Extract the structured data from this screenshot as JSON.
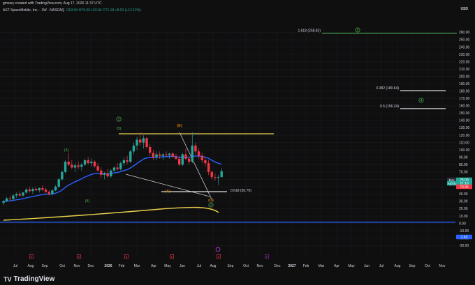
{
  "header": {
    "credit": "gmsery created with TradingView.com, Aug 17, 2026 11:37 UTC",
    "symbol": "AST SpaceMobile, Inc. · 1W · NASDAQ",
    "ohlc": "O63.04 H75.09 L63.04 C71.18 +8.03 (+12.12%)"
  },
  "footer": {
    "brand": "TradingView",
    "logo": "TV"
  },
  "axis": {
    "unit": "USD",
    "price_ticks": [
      260,
      250,
      240,
      230,
      220,
      210,
      200,
      190,
      180,
      170,
      160,
      150,
      140,
      130,
      120,
      110,
      100,
      90,
      80,
      70,
      60,
      50,
      40,
      30,
      20,
      10,
      0,
      -10,
      -20,
      -30
    ],
    "time_ticks": [
      "Jul",
      "Aug",
      "Sep",
      "Oct",
      "Nov",
      "Dec",
      "2026",
      "Feb",
      "Mar",
      "Apr",
      "May",
      "Jun",
      "Jul",
      "Aug",
      "Sep",
      "Oct",
      "Nov",
      "Dec",
      "2027",
      "Feb",
      "Mar",
      "Apr",
      "May",
      "Jun",
      "Jul",
      "Aug",
      "Sep",
      "Oct",
      "Nov"
    ]
  },
  "price_labels": [
    {
      "text": "75.09",
      "color": "#26a69a"
    },
    {
      "text": "71.18",
      "color": "#26a69a"
    },
    {
      "text": "70.96",
      "color": "#f23645"
    },
    {
      "text": "1.63",
      "color": "#2962ff"
    }
  ],
  "price_label_tags": [
    "Buy",
    "ASTS"
  ],
  "fib_levels": [
    {
      "text": "1.618 (258.83)",
      "value": 258.83,
      "color": "#4caf50"
    },
    {
      "text": "0.382 (180.64)",
      "value": 180.64,
      "color": "#ffffff"
    },
    {
      "text": "0.5 (156.24)",
      "value": 156.24,
      "color": "#ffffff"
    },
    {
      "text": "0.618 (50.79)",
      "value": 50.79,
      "color": "#ffffff"
    }
  ],
  "wave_labels": [
    {
      "text": "1",
      "kind": "circle",
      "color": "#4caf50"
    },
    {
      "text": "(5)",
      "kind": "paren",
      "color": "#4caf50"
    },
    {
      "text": "(3)",
      "kind": "paren",
      "color": "#4caf50"
    },
    {
      "text": "(4)",
      "kind": "paren",
      "color": "#4caf50"
    },
    {
      "text": "(B)",
      "kind": "paren",
      "color": "#ff9800"
    },
    {
      "text": "(A)",
      "kind": "paren",
      "color": "#ff9800"
    },
    {
      "text": "(C)",
      "kind": "paren",
      "color": "#ff9800"
    },
    {
      "text": "2",
      "kind": "circle",
      "color": "#4caf50"
    },
    {
      "text": "3",
      "kind": "circle",
      "color": "#4caf50"
    },
    {
      "text": "4",
      "kind": "circle",
      "color": "#4caf50"
    }
  ],
  "event_markers": [
    "E",
    "E",
    "E",
    "E",
    "E",
    "E"
  ],
  "colors": {
    "background": "#0f0f10",
    "up": "#26a69a",
    "down": "#f23645",
    "ema_blue": "#2962ff",
    "ema_yellow": "#e8d04a",
    "trendline_yellow": "#e8d04a",
    "grid": "#1c1f26",
    "text": "#d1d4dc"
  },
  "chart_data": {
    "type": "candlestick",
    "timeframe": "1W",
    "candles": [
      {
        "o": 28,
        "h": 32,
        "l": 25,
        "c": 30
      },
      {
        "o": 30,
        "h": 36,
        "l": 29,
        "c": 34
      },
      {
        "o": 34,
        "h": 38,
        "l": 31,
        "c": 33
      },
      {
        "o": 33,
        "h": 40,
        "l": 32,
        "c": 38
      },
      {
        "o": 38,
        "h": 42,
        "l": 35,
        "c": 40
      },
      {
        "o": 40,
        "h": 44,
        "l": 36,
        "c": 38
      },
      {
        "o": 38,
        "h": 43,
        "l": 36,
        "c": 42
      },
      {
        "o": 42,
        "h": 48,
        "l": 40,
        "c": 46
      },
      {
        "o": 46,
        "h": 50,
        "l": 42,
        "c": 44
      },
      {
        "o": 44,
        "h": 49,
        "l": 40,
        "c": 47
      },
      {
        "o": 47,
        "h": 50,
        "l": 44,
        "c": 45
      },
      {
        "o": 45,
        "h": 49,
        "l": 42,
        "c": 48
      },
      {
        "o": 48,
        "h": 52,
        "l": 44,
        "c": 46
      },
      {
        "o": 46,
        "h": 48,
        "l": 41,
        "c": 43
      },
      {
        "o": 43,
        "h": 45,
        "l": 38,
        "c": 40
      },
      {
        "o": 40,
        "h": 46,
        "l": 38,
        "c": 45
      },
      {
        "o": 45,
        "h": 52,
        "l": 44,
        "c": 50
      },
      {
        "o": 50,
        "h": 62,
        "l": 48,
        "c": 60
      },
      {
        "o": 60,
        "h": 72,
        "l": 58,
        "c": 70
      },
      {
        "o": 70,
        "h": 86,
        "l": 68,
        "c": 84
      },
      {
        "o": 84,
        "h": 96,
        "l": 78,
        "c": 80
      },
      {
        "o": 80,
        "h": 86,
        "l": 74,
        "c": 76
      },
      {
        "o": 76,
        "h": 82,
        "l": 70,
        "c": 79
      },
      {
        "o": 79,
        "h": 84,
        "l": 74,
        "c": 77
      },
      {
        "o": 77,
        "h": 82,
        "l": 72,
        "c": 80
      },
      {
        "o": 80,
        "h": 88,
        "l": 78,
        "c": 86
      },
      {
        "o": 86,
        "h": 90,
        "l": 80,
        "c": 82
      },
      {
        "o": 82,
        "h": 88,
        "l": 78,
        "c": 84
      },
      {
        "o": 84,
        "h": 86,
        "l": 76,
        "c": 78
      },
      {
        "o": 78,
        "h": 82,
        "l": 70,
        "c": 72
      },
      {
        "o": 72,
        "h": 76,
        "l": 62,
        "c": 66
      },
      {
        "o": 66,
        "h": 70,
        "l": 60,
        "c": 68
      },
      {
        "o": 68,
        "h": 74,
        "l": 62,
        "c": 64
      },
      {
        "o": 64,
        "h": 74,
        "l": 62,
        "c": 72
      },
      {
        "o": 72,
        "h": 78,
        "l": 70,
        "c": 76
      },
      {
        "o": 76,
        "h": 82,
        "l": 72,
        "c": 74
      },
      {
        "o": 74,
        "h": 84,
        "l": 72,
        "c": 82
      },
      {
        "o": 82,
        "h": 90,
        "l": 78,
        "c": 86
      },
      {
        "o": 86,
        "h": 92,
        "l": 80,
        "c": 84
      },
      {
        "o": 84,
        "h": 100,
        "l": 82,
        "c": 98
      },
      {
        "o": 98,
        "h": 110,
        "l": 94,
        "c": 106
      },
      {
        "o": 106,
        "h": 118,
        "l": 100,
        "c": 114
      },
      {
        "o": 114,
        "h": 124,
        "l": 106,
        "c": 110
      },
      {
        "o": 110,
        "h": 120,
        "l": 102,
        "c": 116
      },
      {
        "o": 116,
        "h": 118,
        "l": 102,
        "c": 104
      },
      {
        "o": 104,
        "h": 108,
        "l": 92,
        "c": 96
      },
      {
        "o": 96,
        "h": 100,
        "l": 86,
        "c": 90
      },
      {
        "o": 90,
        "h": 98,
        "l": 86,
        "c": 94
      },
      {
        "o": 94,
        "h": 98,
        "l": 88,
        "c": 92
      },
      {
        "o": 92,
        "h": 96,
        "l": 86,
        "c": 94
      },
      {
        "o": 94,
        "h": 98,
        "l": 90,
        "c": 93
      },
      {
        "o": 93,
        "h": 96,
        "l": 88,
        "c": 95
      },
      {
        "o": 95,
        "h": 97,
        "l": 89,
        "c": 91
      },
      {
        "o": 91,
        "h": 95,
        "l": 86,
        "c": 88
      },
      {
        "o": 88,
        "h": 92,
        "l": 78,
        "c": 80
      },
      {
        "o": 80,
        "h": 96,
        "l": 78,
        "c": 94
      },
      {
        "o": 94,
        "h": 102,
        "l": 86,
        "c": 88
      },
      {
        "o": 88,
        "h": 92,
        "l": 80,
        "c": 84
      },
      {
        "o": 84,
        "h": 124,
        "l": 82,
        "c": 106
      },
      {
        "o": 106,
        "h": 110,
        "l": 94,
        "c": 98
      },
      {
        "o": 98,
        "h": 102,
        "l": 88,
        "c": 92
      },
      {
        "o": 92,
        "h": 96,
        "l": 82,
        "c": 86
      },
      {
        "o": 86,
        "h": 90,
        "l": 78,
        "c": 82
      },
      {
        "o": 82,
        "h": 86,
        "l": 66,
        "c": 70
      },
      {
        "o": 70,
        "h": 72,
        "l": 60,
        "c": 63
      },
      {
        "o": 63,
        "h": 68,
        "l": 58,
        "c": 62
      },
      {
        "o": 62,
        "h": 66,
        "l": 52,
        "c": 63
      },
      {
        "o": 63,
        "h": 75.09,
        "l": 63,
        "c": 71.18
      }
    ]
  }
}
